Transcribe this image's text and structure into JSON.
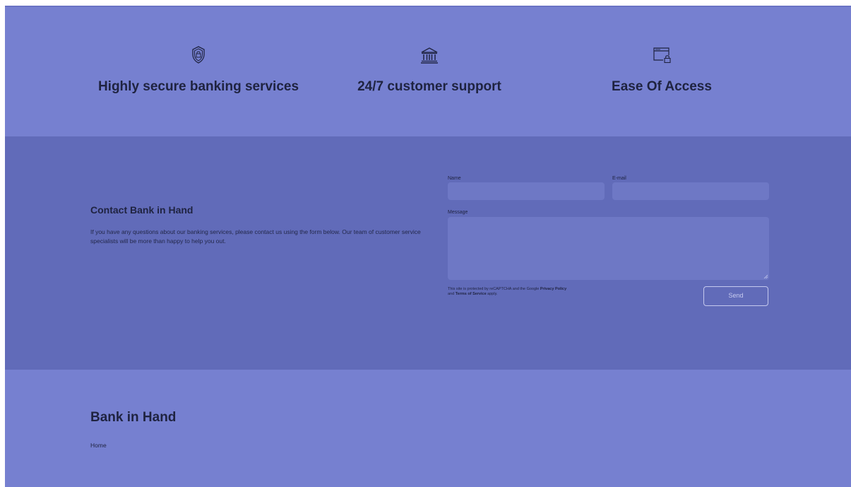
{
  "features": [
    {
      "icon": "shield-lock-icon",
      "title": "Highly secure banking services"
    },
    {
      "icon": "bank-building-icon",
      "title": "24/7 customer support"
    },
    {
      "icon": "browser-lock-icon",
      "title": "Ease Of Access"
    }
  ],
  "contact": {
    "heading": "Contact Bank in Hand",
    "description": "If you have any questions about our banking services, please contact us using the form below. Our team of customer service specialists will be more than happy to help you out.",
    "form": {
      "name_label": "Name",
      "name_value": "",
      "email_label": "E-mail",
      "email_value": "",
      "message_label": "Message",
      "message_value": "",
      "notice_prefix": "This site is protected by reCAPTCHA and the Google ",
      "privacy_link": "Privacy Policy",
      "notice_middle": "and ",
      "terms_link": "Terms of Service",
      "notice_suffix": " apply.",
      "send_label": "Send"
    }
  },
  "footer": {
    "brand": "Bank in Hand",
    "links": [
      "Home"
    ]
  },
  "colors": {
    "band_light": "#7680d0",
    "band_dark": "#616bb9",
    "text_dark": "#1f2340",
    "input_fill": "#6e78c5"
  }
}
